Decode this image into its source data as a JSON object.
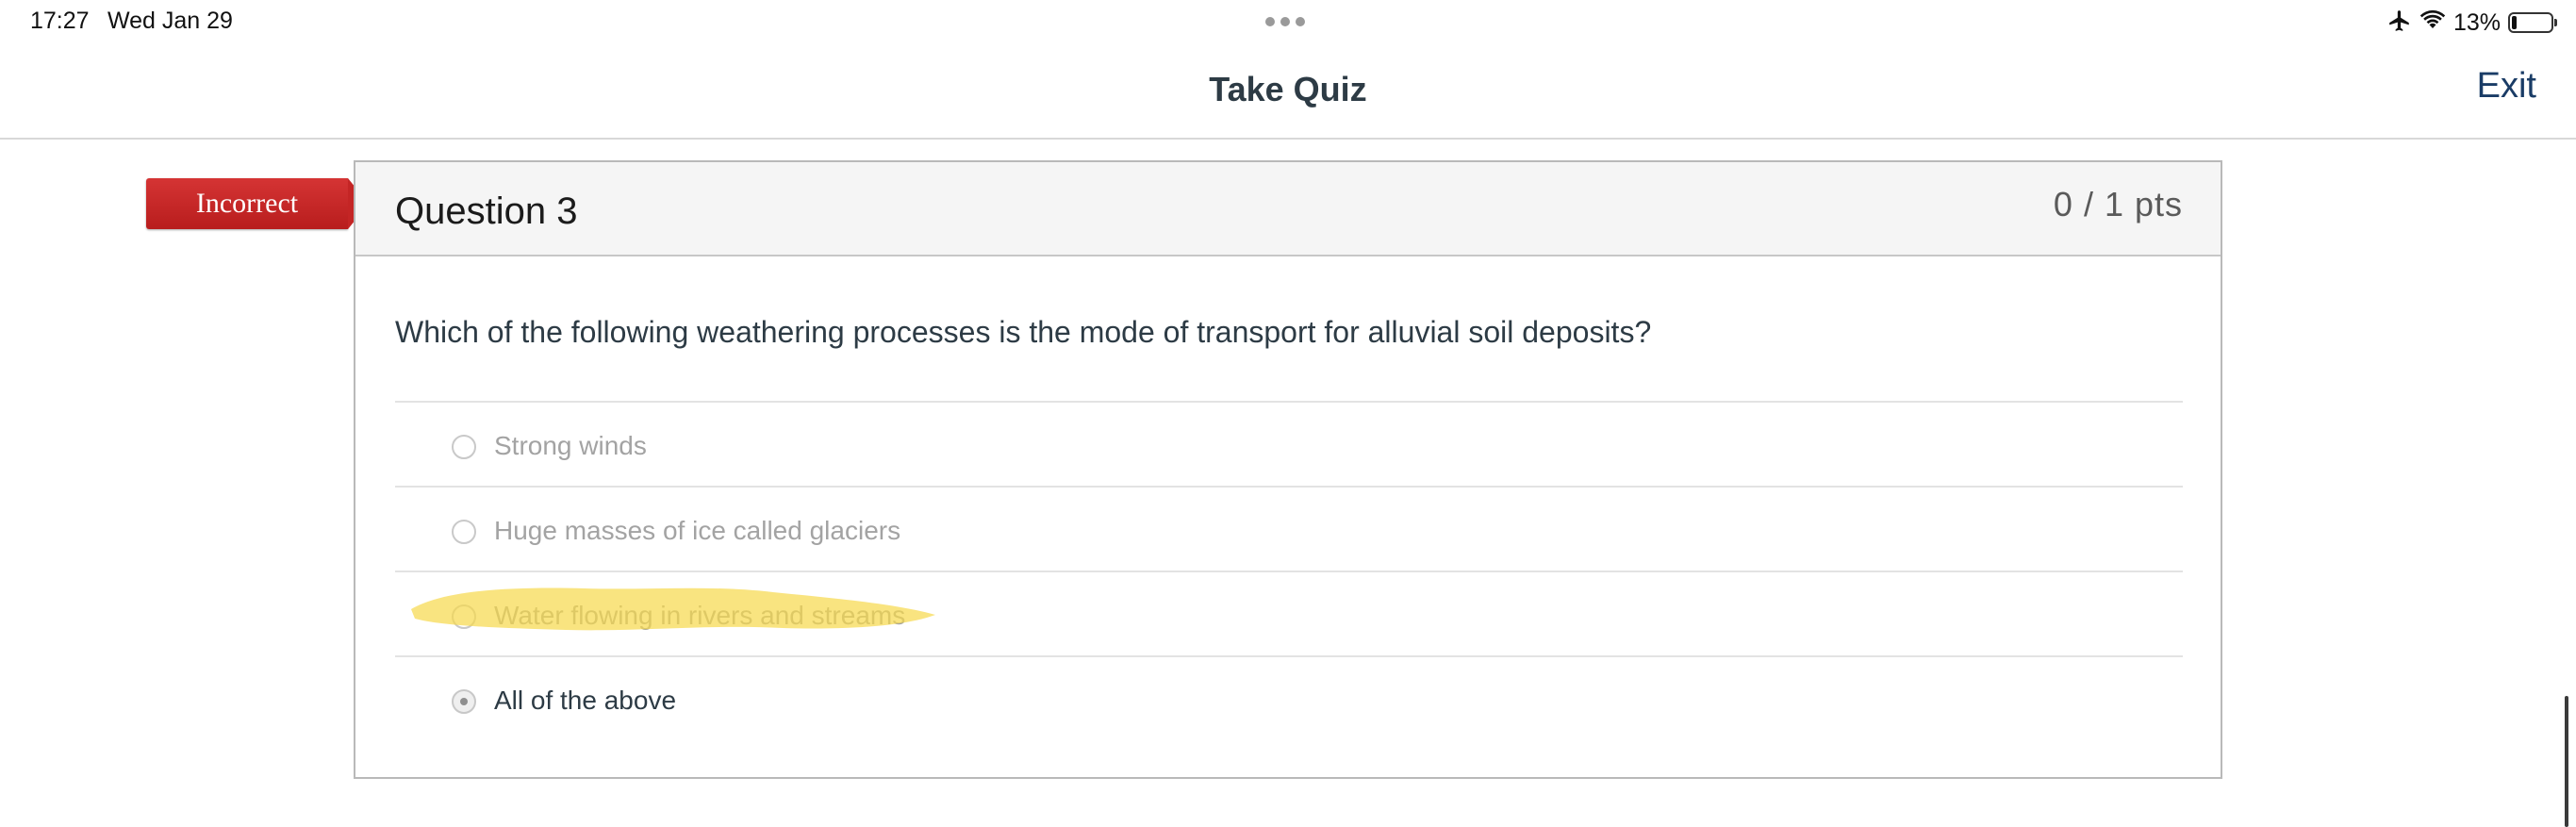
{
  "status_bar": {
    "time": "17:27",
    "date": "Wed Jan 29",
    "battery_percent": "13%",
    "battery_level": 0.13,
    "icons": [
      "airplane-icon",
      "wifi-icon",
      "battery-icon"
    ]
  },
  "header": {
    "title": "Take Quiz",
    "exit_label": "Exit"
  },
  "question": {
    "result_badge": "Incorrect",
    "title": "Question 3",
    "points": "0 / 1 pts",
    "text": "Which of the following weathering processes is the mode of transport for alluvial soil deposits?",
    "answers": [
      {
        "label": "Strong winds",
        "selected": false
      },
      {
        "label": "Huge masses of ice called glaciers",
        "selected": false
      },
      {
        "label": "Water flowing in rivers and streams",
        "selected": false
      },
      {
        "label": "All of the above",
        "selected": true
      }
    ]
  },
  "colors": {
    "incorrect_badge": "#c42525",
    "title_text": "#2d3b45",
    "exit_link": "#1a3c66",
    "highlight": "#f7d84a"
  }
}
